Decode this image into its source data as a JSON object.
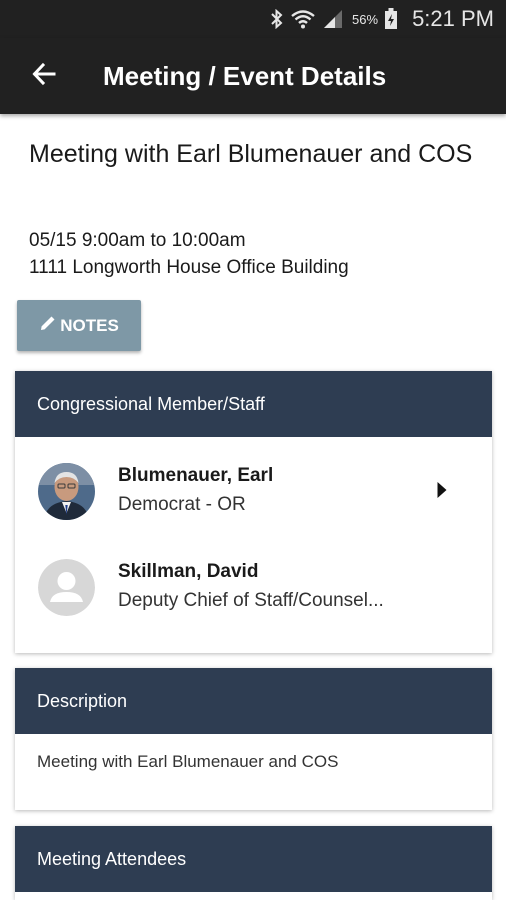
{
  "status_bar": {
    "battery_percent": "56%",
    "time": "5:21 PM",
    "icons": [
      "bluetooth-icon",
      "wifi-icon",
      "cell-signal-icon",
      "battery-charging-icon"
    ]
  },
  "app_bar": {
    "back_icon": "arrow-left-icon",
    "title": "Meeting / Event Details"
  },
  "meeting": {
    "title": "Meeting with Earl Blumenauer and COS",
    "time": "05/15 9:00am to 10:00am",
    "location": "1111 Longworth House Office Building"
  },
  "notes_button": {
    "icon": "pencil-icon",
    "label": "NOTES",
    "color": "#7e98a6"
  },
  "members_card": {
    "header": "Congressional Member/Staff",
    "header_color": "#2e3d52",
    "members": [
      {
        "name": "Blumenauer, Earl",
        "subtitle": "Democrat - OR",
        "avatar": "member-photo",
        "has_chevron": true
      },
      {
        "name": "Skillman, David",
        "subtitle": "Deputy Chief of Staff/Counsel...",
        "avatar": "person-placeholder-icon",
        "has_chevron": false
      }
    ]
  },
  "description_card": {
    "header": "Description",
    "text": "Meeting with Earl Blumenauer and COS"
  },
  "attendees_card": {
    "header": "Meeting Attendees"
  }
}
